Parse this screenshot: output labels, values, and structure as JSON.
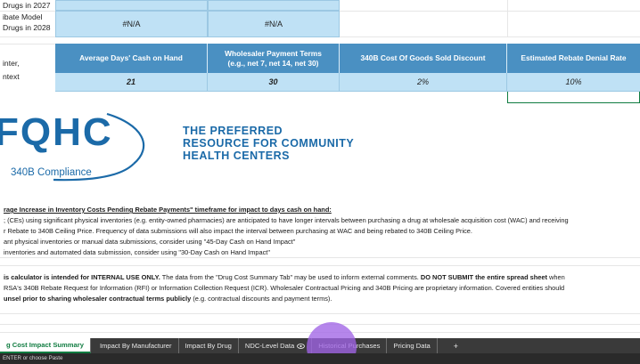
{
  "top_rows": [
    {
      "label": "Drugs in 2027",
      "col1": "#N/A",
      "col2": "#N/A"
    },
    {
      "label1": "ibate Model",
      "label2": "Drugs in 2028",
      "col1": "#N/A",
      "col2": "#N/A"
    }
  ],
  "side_label": {
    "line1": "inter,",
    "line2": "ntext"
  },
  "table": {
    "headers": [
      "Average Days' Cash on Hand",
      "Wholesaler Payment Terms",
      "(e.g., net 7, net 14, net 30)",
      "340B Cost Of Goods Sold Discount",
      "Estimated Rebate Denial Rate"
    ],
    "values": [
      "21",
      "30",
      "2%",
      "10%"
    ]
  },
  "logo": {
    "letters": "FQHC",
    "sub": "340B Compliance",
    "tag1": "THE PREFERRED",
    "tag2": "RESOURCE FOR COMMUNITY",
    "tag3": "HEALTH CENTERS"
  },
  "notes": {
    "heading": "rage Increase in Inventory Costs Pending Rebate Payments\" timeframe for impact to days cash on hand:",
    "line1": "; (CEs) using significant physical inventories (e.g. entity-owned pharmacies) are anticipated to have longer intervals between purchasing a drug at wholesale acquisition cost (WAC) and receiving",
    "line2": "r Rebate to 340B Ceiling Price. Frequency of data submissions will also impact the interval between purchasing at WAC and being rebated to 340B Ceiling Price.",
    "line3": "ant physical inventories or manual data submissions, consider using \"45-Day Cash on Hand Impact\"",
    "line4": "inventories and automated data submission, consider using \"30-Day Cash on Hand Impact\""
  },
  "disclaimer": {
    "l1_bold": "is calculator is intended for INTERNAL USE ONLY.",
    "l1_mid": " The data from the \"Drug Cost Summary Tab\" may be used to inform external comments. ",
    "l1_bold2": "DO NOT SUBMIT the entire spread sheet",
    "l1_end": " when",
    "l2": "RSA's 340B Rebate Request for Information (RFI) or Information Collection Request (ICR). Wholesaler Contractual Pricing and 340B Pricing are proprietary information. Covered entities should",
    "l3_bold": "unsel prior to sharing wholesaler contractual terms publicly",
    "l3_end": " (e.g. contractual discounts and payment terms)."
  },
  "tabs": [
    "g Cost Impact Summary",
    "Impact By Manufacturer",
    "Impact By Drug",
    "NDC-Level Data",
    "Historical Purchases",
    "Pricing Data",
    "+"
  ],
  "status": "ENTER or choose Paste",
  "colors": {
    "header_blue": "#4a90c2",
    "cell_blue": "#bfe1f5",
    "logo_blue": "#1b6aa8",
    "pointer": "#a064e6"
  }
}
